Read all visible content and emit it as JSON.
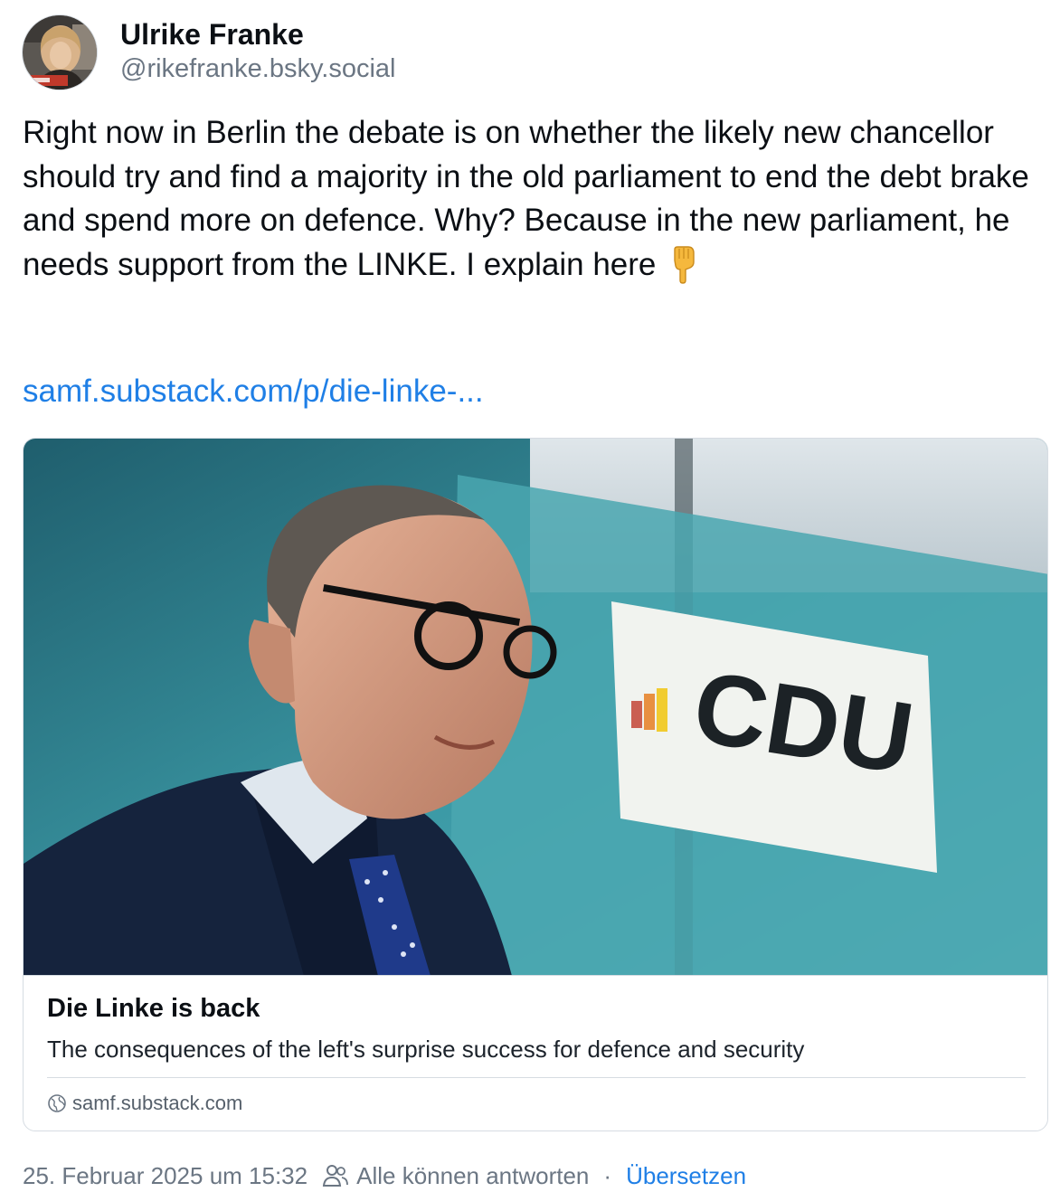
{
  "author": {
    "display_name": "Ulrike Franke",
    "handle": "@rikefranke.bsky.social",
    "avatar_icon": "profile-photo"
  },
  "post": {
    "text": "Right now in Berlin the debate is on whether the likely new chancellor should try and find a majority in the old parliament to end the debt brake and spend more on defence. Why? Because in the new parliament, he needs support from the LINKE. I explain here",
    "emoji": "👇",
    "link_text": "samf.substack.com/p/die-linke-..."
  },
  "link_card": {
    "image_icon": "article-photo-man-glasses-cdu-backdrop",
    "image_sign_text": "CDU",
    "title": "Die Linke is back",
    "description": "The consequences of the left's surprise success for defence and security",
    "domain": "samf.substack.com",
    "domain_icon": "globe-icon"
  },
  "meta": {
    "timestamp": "25. Februar 2025 um 15:32",
    "reply_icon": "people-icon",
    "reply_setting": "Alle können antworten",
    "separator": "·",
    "translate_label": "Übersetzen"
  },
  "colors": {
    "link": "#1f7fe6",
    "muted": "#6b7683",
    "text": "#0b0f14",
    "border": "#d6dce2"
  }
}
